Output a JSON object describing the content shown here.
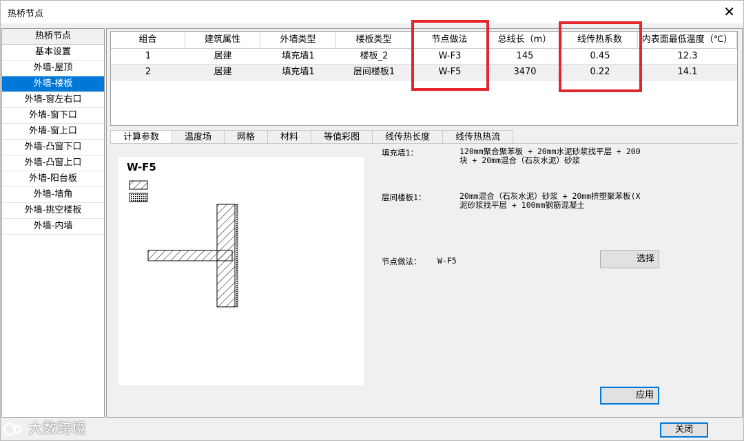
{
  "window": {
    "title": "热桥节点",
    "close_glyph": "✕"
  },
  "sidebar": {
    "header": "热桥节点",
    "items": [
      {
        "label": "基本设置"
      },
      {
        "label": "外墙-屋顶"
      },
      {
        "label": "外墙-楼板",
        "selected": true
      },
      {
        "label": "外墙-窗左右口"
      },
      {
        "label": "外墙-窗下口"
      },
      {
        "label": "外墙-窗上口"
      },
      {
        "label": "外墙-凸窗下口"
      },
      {
        "label": "外墙-凸窗上口"
      },
      {
        "label": "外墙-阳台板"
      },
      {
        "label": "外墙-墙角"
      },
      {
        "label": "外墙-挑空楼板"
      },
      {
        "label": "外墙-内墙"
      }
    ]
  },
  "grid": {
    "columns": [
      "组合",
      "建筑属性",
      "外墙类型",
      "楼板类型",
      "节点做法",
      "总线长（m）",
      "线传热系数",
      "内表面最低温度（℃）"
    ],
    "rows": [
      [
        "1",
        "居建",
        "填充墙1",
        "楼板_2",
        "W-F3",
        "145",
        "0.45",
        "12.3"
      ],
      [
        "2",
        "居建",
        "填充墙1",
        "层间楼板1",
        "W-F5",
        "3470",
        "0.22",
        "14.1"
      ]
    ]
  },
  "highlight_color": "#e3262b",
  "tabs": [
    "计算参数",
    "温度场",
    "网格",
    "材料",
    "等值彩图",
    "线传热长度",
    "线传热热流"
  ],
  "active_tab": 0,
  "detail": {
    "node_name": "W-F5",
    "wall_label": "填充墙1：",
    "wall_desc_line1": "120mm聚合聚苯板 + 20mm水泥砂浆找平层 + 200",
    "wall_desc_line2": "块 + 20mm混合（石灰水泥）砂浆",
    "slab_label": "层间楼板1：",
    "slab_desc_line1": "20mm混合（石灰水泥）砂浆 + 20mm挤塑聚苯板(X",
    "slab_desc_line2": "泥砂浆找平层 + 100mm钢筋混凝土",
    "method_label": "节点做法：",
    "method_value": "W-F5",
    "select_button": "选择",
    "apply_button": "应用"
  },
  "footer": {
    "close_button": "关闭",
    "watermark": "大数跨境"
  }
}
